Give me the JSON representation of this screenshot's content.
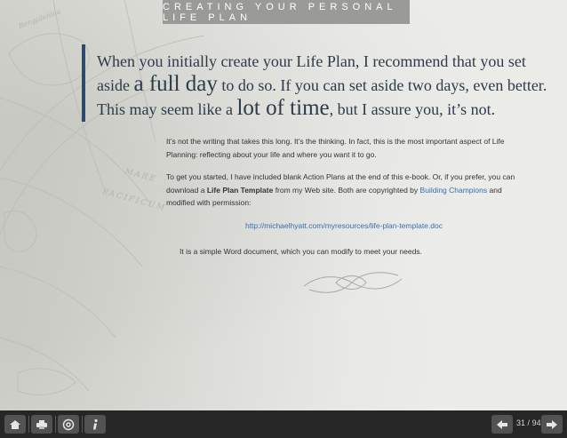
{
  "header": {
    "title": "CREATING YOUR PERSONAL LIFE PLAN"
  },
  "quote": {
    "part1": "When you initially create your Life Plan, I recommend that you set",
    "part2": "aside ",
    "emph1": "a full day",
    "part3": " to do so. If you can set aside two days, even better.",
    "part4": "This may seem like a ",
    "emph2": "lot of time",
    "part5": ", but I assure you, it’s not."
  },
  "body": {
    "para1": "It’s not the writing that takes this long. It’s the thinking. In fact, this is the most important aspect of Life Planning: reflecting about your life and where you want it to go.",
    "para2_a": "To get you started, I have included blank Action Plans at the end of this e-book. Or, if you prefer, you can download a ",
    "para2_bold": "Life Plan Template",
    "para2_b": " from my Web site. Both are copyrighted by ",
    "para2_link": "Building Champions",
    "para2_c": " and modified with permission:",
    "url": "http://michaelhyatt.com/myresources/life-plan-template.doc",
    "para3": "It is a simple Word document, which you can modify to meet your needs."
  },
  "map_labels": [
    "Bengalenica",
    "MARE",
    "PACIFICUM"
  ],
  "toolbar": {
    "icons": [
      "home-icon",
      "print-icon",
      "email-icon",
      "info-icon"
    ],
    "prev_icon": "arrow-left-icon",
    "next_icon": "arrow-right-icon",
    "current_page": "31",
    "separator": "/",
    "total_pages": "94"
  },
  "colors": {
    "header_bar": "#9a9a96",
    "accent": "#2d4a6b",
    "quote_text": "#2d3a4a",
    "link": "#3a6fb2",
    "toolbar": "#262626"
  }
}
